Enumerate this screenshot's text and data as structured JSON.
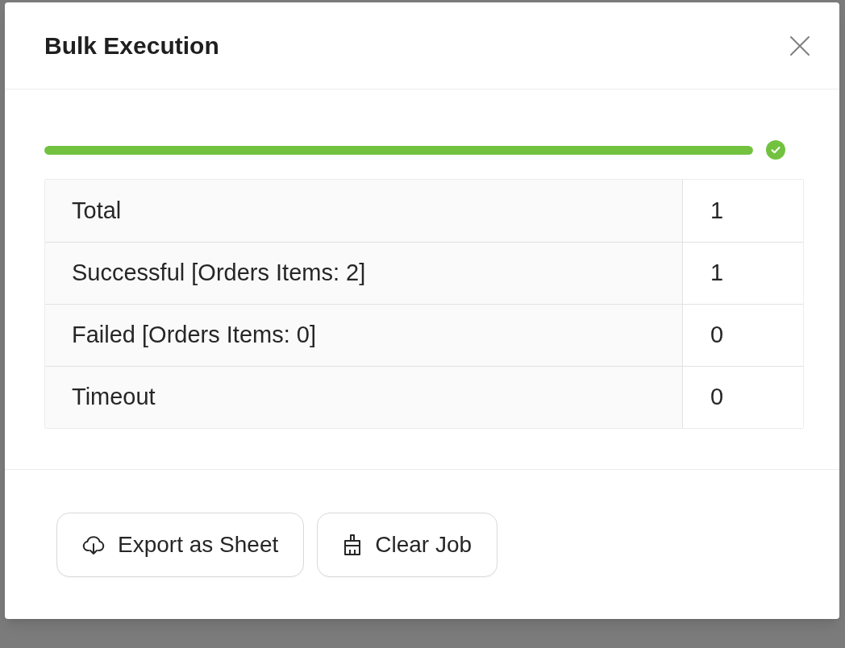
{
  "dialog": {
    "title": "Bulk Execution"
  },
  "progress": {
    "level": 1,
    "succeeded": true
  },
  "summary": {
    "rows": [
      {
        "label": "Total",
        "value": "1"
      },
      {
        "label": "Successful [Orders Items: 2]",
        "value": "1"
      },
      {
        "label": "Failed [Orders Items: 0]",
        "value": "0"
      },
      {
        "label": "Timeout",
        "value": "0"
      }
    ]
  },
  "buttons": [
    {
      "label": "Export as Sheet",
      "kind": "export"
    },
    {
      "label": "Clear Job",
      "kind": "clear"
    }
  ]
}
